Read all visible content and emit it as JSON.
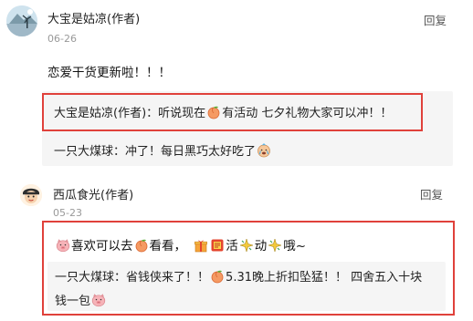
{
  "comments": [
    {
      "author": "大宝是姑凉(作者)",
      "date": "06-26",
      "reply_label": "回复",
      "text": "恋爱干货更新啦！！！",
      "replies": [
        {
          "author": "大宝是姑凉(作者)",
          "sep": "：",
          "parts": [
            "听说现在",
            "有活动 七夕礼物大家可以冲！！"
          ],
          "icons": [
            "peach-emoji-icon"
          ]
        },
        {
          "author": "一只大煤球",
          "sep": "：",
          "parts": [
            "冲了！每日黑巧太好吃了"
          ],
          "icons": [
            "crying-face-emoji-icon"
          ]
        }
      ]
    },
    {
      "author": "西瓜食光(作者)",
      "date": "05-23",
      "reply_label": "回复",
      "text_parts": [
        "喜欢可以去",
        "看看，",
        "活",
        "动",
        "哦~"
      ],
      "icons": [
        "pig-face-emoji-icon",
        "peach-emoji-icon",
        "gift-emoji-icon",
        "red-label-emoji-icon",
        "sparkle-emoji-icon",
        "sparkle-emoji-icon"
      ],
      "replies": [
        {
          "author": "一只大煤球",
          "sep": "：",
          "parts": [
            "省钱侠来了！！",
            "5.31晚上折扣坠猛！！ 四舍五入十块钱一包"
          ],
          "icons": [
            "peach-emoji-icon",
            "pig-face-emoji-icon"
          ]
        }
      ]
    }
  ],
  "colors": {
    "highlight_border": "#e0413b",
    "reply_bg": "#f5f5f5"
  }
}
